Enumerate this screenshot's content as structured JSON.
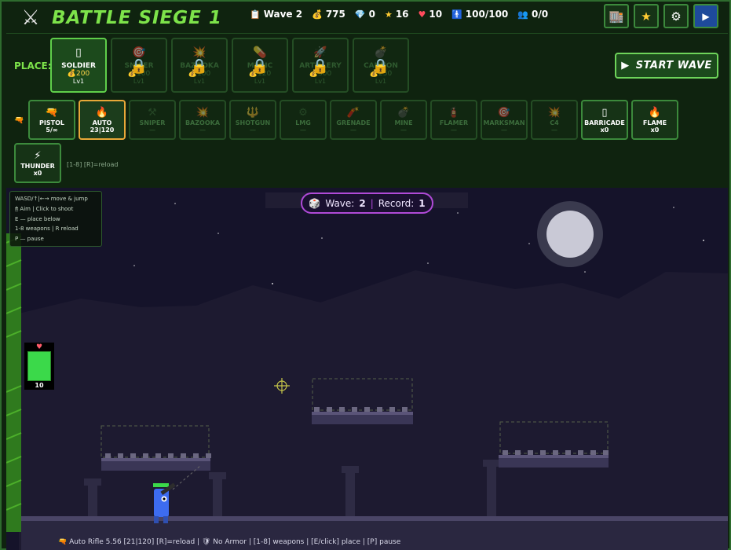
{
  "header": {
    "title": "BATTLE SIEGE 1",
    "logo_icon": "crossed-swords-icon",
    "stats": [
      {
        "icon": "clipboard-icon",
        "glyph": "📋",
        "value": "Wave 2"
      },
      {
        "icon": "coin-icon",
        "glyph": "💰",
        "value": "775"
      },
      {
        "icon": "diamond-icon",
        "glyph": "💎",
        "value": "0"
      },
      {
        "icon": "star-icon",
        "glyph": "★",
        "value": "16"
      },
      {
        "icon": "heart-icon",
        "glyph": "♥",
        "value": "10"
      },
      {
        "icon": "person-icon",
        "glyph": "🚹",
        "value": "100/100"
      },
      {
        "icon": "group-icon",
        "glyph": "👥",
        "value": "0/0"
      }
    ],
    "buttons": [
      {
        "name": "shop-button",
        "icon": "shop-icon",
        "glyph": "🏬"
      },
      {
        "name": "favorites-button",
        "icon": "star-icon",
        "glyph": "★"
      },
      {
        "name": "settings-button",
        "icon": "gear-icon",
        "glyph": "⚙"
      },
      {
        "name": "play-button",
        "icon": "play-icon",
        "glyph": "▶"
      }
    ]
  },
  "place": {
    "label": "PLACE:",
    "units": [
      {
        "name": "SOLDIER",
        "glyph": "▯",
        "cost": "💰200",
        "level": "Lv1",
        "selected": true,
        "locked": false
      },
      {
        "name": "SNIPER",
        "glyph": "🎯",
        "cost": "💰100",
        "level": "Lv1",
        "selected": false,
        "locked": true
      },
      {
        "name": "BAZOOKA",
        "glyph": "💥",
        "cost": "💰100",
        "level": "Lv1",
        "selected": false,
        "locked": true
      },
      {
        "name": "MEDIC",
        "glyph": "💊",
        "cost": "💰120",
        "level": "Lv1",
        "selected": false,
        "locked": true
      },
      {
        "name": "ARTILLERY",
        "glyph": "🚀",
        "cost": "💰300",
        "level": "Lv1",
        "selected": false,
        "locked": true
      },
      {
        "name": "CANNON",
        "glyph": "💣",
        "cost": "💰250",
        "level": "Lv1",
        "selected": false,
        "locked": true
      }
    ],
    "start_label": "START WAVE"
  },
  "weapons": {
    "lead_icon": "gun-icon",
    "items": [
      {
        "name": "PISTOL",
        "glyph": "🔫",
        "sub": "5/∞",
        "state": "avail"
      },
      {
        "name": "AUTO",
        "glyph": "🔥",
        "sub": "23|120",
        "state": "sel"
      },
      {
        "name": "SNIPER",
        "glyph": "⚒",
        "sub": "—",
        "state": "dim"
      },
      {
        "name": "BAZOOKA",
        "glyph": "💥",
        "sub": "—",
        "state": "dim"
      },
      {
        "name": "SHOTGUN",
        "glyph": "🔱",
        "sub": "—",
        "state": "dim"
      },
      {
        "name": "LMG",
        "glyph": "⚙",
        "sub": "—",
        "state": "dim"
      },
      {
        "name": "GRENADE",
        "glyph": "🧨",
        "sub": "—",
        "state": "dim"
      },
      {
        "name": "MINE",
        "glyph": "💣",
        "sub": "—",
        "state": "dim"
      },
      {
        "name": "FLAMER",
        "glyph": "🧯",
        "sub": "—",
        "state": "dim"
      },
      {
        "name": "MARKSMAN",
        "glyph": "🎯",
        "sub": "—",
        "state": "dim"
      },
      {
        "name": "C4",
        "glyph": "💥",
        "sub": "—",
        "state": "dim"
      },
      {
        "name": "BARRICADE",
        "glyph": "▯",
        "sub": "x0",
        "state": "avail"
      },
      {
        "name": "FLAME",
        "glyph": "🔥",
        "sub": "x0",
        "state": "avail"
      },
      {
        "name": "THUNDER",
        "glyph": "⚡",
        "sub": "x0",
        "state": "avail"
      }
    ],
    "reload_hint": "[1-8] [R]=reload"
  },
  "controls_hint": [
    "WASD/↑|←→ move & jump",
    "🖱 Aim | Click to shoot",
    "E — place below",
    "1-8 weapons | R reload",
    "P — pause"
  ],
  "wave_banner": {
    "icon": "dice-icon",
    "glyph": "🎲",
    "wave_label": "Wave:",
    "wave_value": "2",
    "record_label": "Record:",
    "record_value": "1"
  },
  "player_hp": {
    "heart": "♥",
    "value": "10"
  },
  "status_line": "🔫 Auto Rifle 5.56 [21|120] [R]=reload | 🛡 No Armor | [1-8] weapons | [E/click] place | [P] pause",
  "colors": {
    "accent": "#7de34a",
    "selected_border": "#e8a838",
    "wave_border": "#b04ad8",
    "sky": "#15132a",
    "hp": "#3bd94a"
  }
}
